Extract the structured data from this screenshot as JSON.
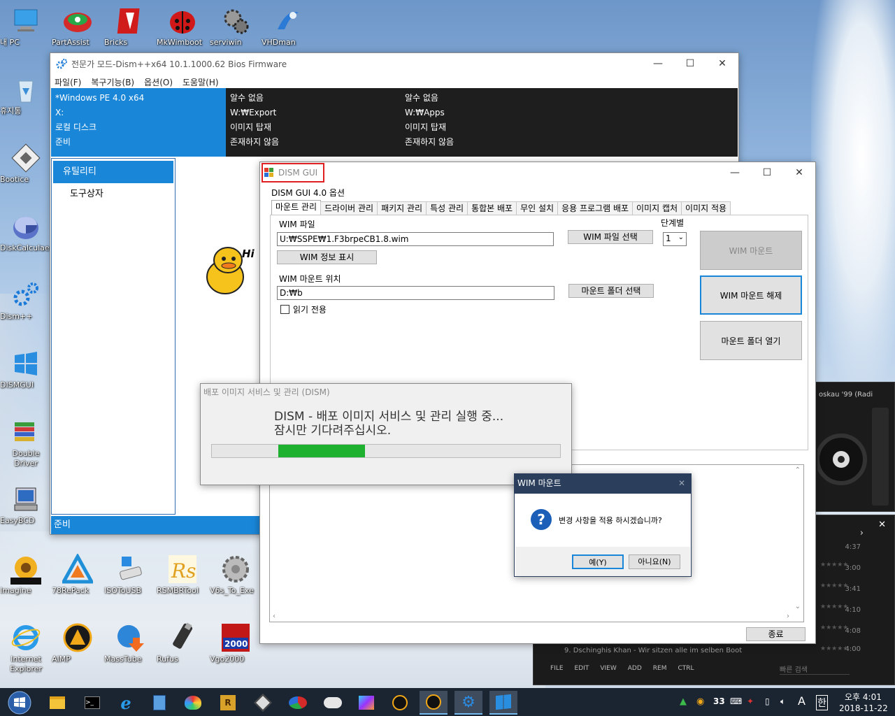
{
  "desktop": {
    "icons": [
      {
        "label": "내 PC",
        "icon": "computer-icon"
      },
      {
        "label": "PartAssist",
        "icon": "partassist-icon"
      },
      {
        "label": "Bricks",
        "icon": "bricks-icon"
      },
      {
        "label": "MkWimboot",
        "icon": "mkwimboot-icon"
      },
      {
        "label": "serviwin",
        "icon": "serviwin-icon"
      },
      {
        "label": "VHDman",
        "icon": "vhdman-icon"
      },
      {
        "label": "휴지통",
        "icon": "recycle-bin-icon"
      },
      {
        "label": "Bootice",
        "icon": "bootice-icon"
      },
      {
        "label": "DiskCalculae",
        "icon": "diskcalculator-icon"
      },
      {
        "label": "Dism++",
        "icon": "dism-plus-icon"
      },
      {
        "label": "DISMGUI",
        "icon": "dismgui-icon"
      },
      {
        "label": "Double Driver",
        "icon": "double-driver-icon"
      },
      {
        "label": "EasyBCD",
        "icon": "easybcd-icon"
      },
      {
        "label": "Imagine",
        "icon": "imagine-icon"
      },
      {
        "label": "78RePack",
        "icon": "repack-icon"
      },
      {
        "label": "ISOToUSB",
        "icon": "isotousb-icon"
      },
      {
        "label": "RSMBRTool",
        "icon": "rsmbrtool-icon"
      },
      {
        "label": "V6s_To_Exe",
        "icon": "v6s-icon"
      },
      {
        "label": "Internet Explorer",
        "icon": "ie-icon"
      },
      {
        "label": "AIMP",
        "icon": "aimp-icon"
      },
      {
        "label": "MassTube",
        "icon": "masstube-icon"
      },
      {
        "label": "Rufus",
        "icon": "rufus-icon"
      },
      {
        "label": "Vgo2000",
        "icon": "vgo2000-icon"
      }
    ]
  },
  "dism_plus": {
    "title": "전문가 모드-Dism++x64 10.1.1000.62 Bios Firmware",
    "menu": [
      "파일(F)",
      "복구기능(B)",
      "옵션(O)",
      "도움말(H)"
    ],
    "info_columns": [
      [
        "*Windows PE 4.0 x64",
        "X:",
        "로컬 디스크",
        "준비"
      ],
      [
        "알수 없음",
        "W:₩Export",
        "이미지 탑재",
        "존재하지 않음"
      ],
      [
        "알수 없음",
        "W:₩Apps",
        "이미지 탑재",
        "존재하지 않음"
      ]
    ],
    "nav": [
      "유틸리티",
      "도구상자"
    ],
    "mascot_text": "Hi",
    "status": "준비"
  },
  "dism_gui": {
    "title": "DISM GUI",
    "options_label": "DISM GUI 4.0 옵션",
    "tabs": [
      "마운트 관리",
      "드라이버 관리",
      "패키지 관리",
      "특성 관리",
      "통합본 배포",
      "무인 설치",
      "응용 프로그램 배포",
      "이미지 캡처",
      "이미지 적용"
    ],
    "wim_file_label": "WIM 파일",
    "wim_file_value": "U:₩SSPE₩1.F3brpeCB1.8.wim",
    "wim_file_select": "WIM 파일 선택",
    "index_label": "단계별",
    "index_value": "1",
    "wim_info": "WIM 정보 표시",
    "mount_location_label": "WIM 마운트 위치",
    "mount_location_value": "D:₩b",
    "mount_folder_select": "마운트 폴더 선택",
    "readonly_label": "읽기 전용",
    "readonly_checked": false,
    "mount_btn": "WIM 마운트",
    "unmount_btn": "WIM 마운트 해제",
    "open_folder_btn": "마운트 폴더 열기",
    "close_btn": "종료"
  },
  "progress_dialog": {
    "title": "배포 이미지 서비스 및 관리 (DISM)",
    "line1": "DISM - 배포 이미지 서비스 및 관리 실행 중...",
    "line2": "잠시만 기다려주십시오.",
    "progress_start_fraction": 0.19,
    "progress_end_fraction": 0.44
  },
  "message_box": {
    "title": "WIM 마운트",
    "message": "변경 사항을 적용 하시겠습니까?",
    "yes": "예(Y)",
    "no": "아니요(N)"
  },
  "aimp": {
    "station": "oskau '99 (Radi",
    "times": [
      "4:37",
      "3:00",
      "3:41",
      "4:10",
      "4:08",
      "4:00"
    ],
    "track": "9. Dschinghis Khan - Wir sitzen alle im selben Boot",
    "buttons": [
      "FILE",
      "EDIT",
      "VIEW",
      "ADD",
      "REM",
      "CTRL"
    ],
    "search_placeholder": "빠른 검색"
  },
  "taskbar": {
    "apps": [
      "file-explorer-icon",
      "cmd-icon",
      "ie-icon",
      "notepad-icon",
      "paint-icon",
      "rsmbr-icon",
      "bootice-icon",
      "partassist-icon",
      "cloud-icon",
      "media-icon",
      "aimp-icon",
      "aimp-play-icon",
      "dism-plus-icon",
      "dismgui-icon"
    ],
    "tray_number": "33",
    "lang": "A",
    "ime": "한",
    "time": "오후 4:01",
    "date": "2018-11-22"
  },
  "colors": {
    "accent": "#1a86d8",
    "highlight_box": "#e02020",
    "progress_fill": "#1db12f",
    "taskbar": "#1b2431"
  }
}
